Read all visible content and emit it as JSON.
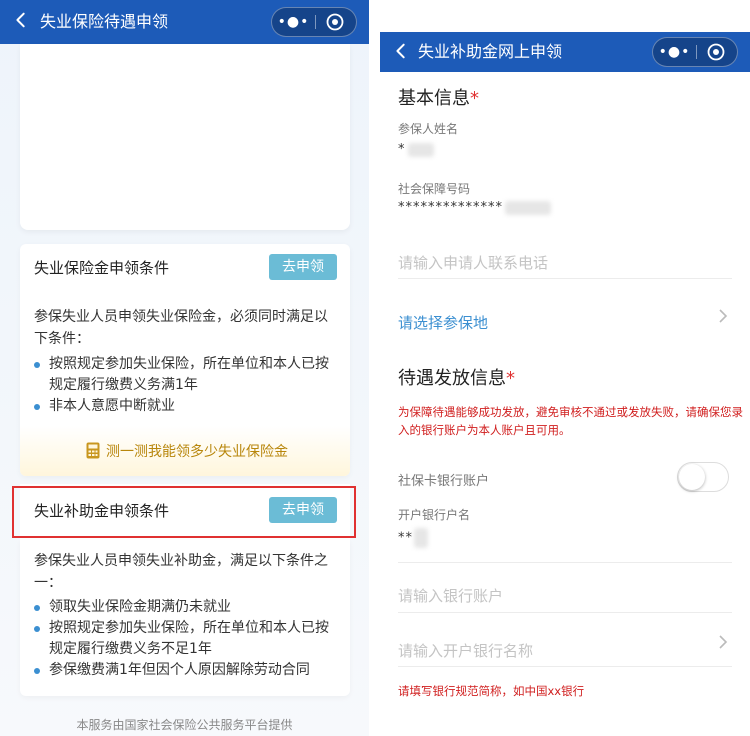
{
  "left": {
    "nav_title": "失业保险待遇申领",
    "card1": {
      "title": "失业保险金申领条件",
      "apply_label": "去申领",
      "desc": "参保失业人员申领失业保险金，必须同时满足以下条件：",
      "bullets": [
        "按照规定参加失业保险，所在单位和本人已按规定履行缴费义务满1年",
        "非本人意愿中断就业"
      ],
      "calc_link": "测一测我能领多少失业保险金"
    },
    "card2": {
      "title": "失业补助金申领条件",
      "apply_label": "去申领",
      "desc": "参保失业人员申领失业补助金，满足以下条件之一：",
      "bullets": [
        "领取失业保险金期满仍未就业",
        "按照规定参加失业保险，所在单位和本人已按规定履行缴费义务不足1年",
        "参保缴费满1年但因个人原因解除劳动合同"
      ]
    },
    "footer": "本服务由国家社会保险公共服务平台提供"
  },
  "right": {
    "nav_title": "失业补助金网上申领",
    "basic": {
      "title": "基本信息",
      "required_mark": "*",
      "name_label": "参保人姓名",
      "name_value": "*",
      "ssn_label": "社会保障号码",
      "ssn_value": "**************",
      "phone_placeholder": "请输入申请人联系电话",
      "insured_place": "请选择参保地"
    },
    "payment": {
      "title": "待遇发放信息",
      "required_mark": "*",
      "warning": "为保障待遇能够成功发放，避免审核不通过或发放失败，请确保您录入的银行账户为本人账户且可用。",
      "card_toggle_label": "社保卡银行账户",
      "toggle_on": false,
      "account_name_label": "开户银行户名",
      "account_name_value": "**",
      "account_placeholder": "请输入银行账户",
      "bank_placeholder": "请输入开户银行名称",
      "bank_hint": "请填写银行规范简称，如中国xx银行"
    }
  },
  "colors": {
    "nav": "#1d5bb8",
    "apply_button": "#6bbcd6",
    "accent_blue": "#3b8fd1",
    "required_red": "#e03131",
    "highlight_box": "#e03131"
  }
}
